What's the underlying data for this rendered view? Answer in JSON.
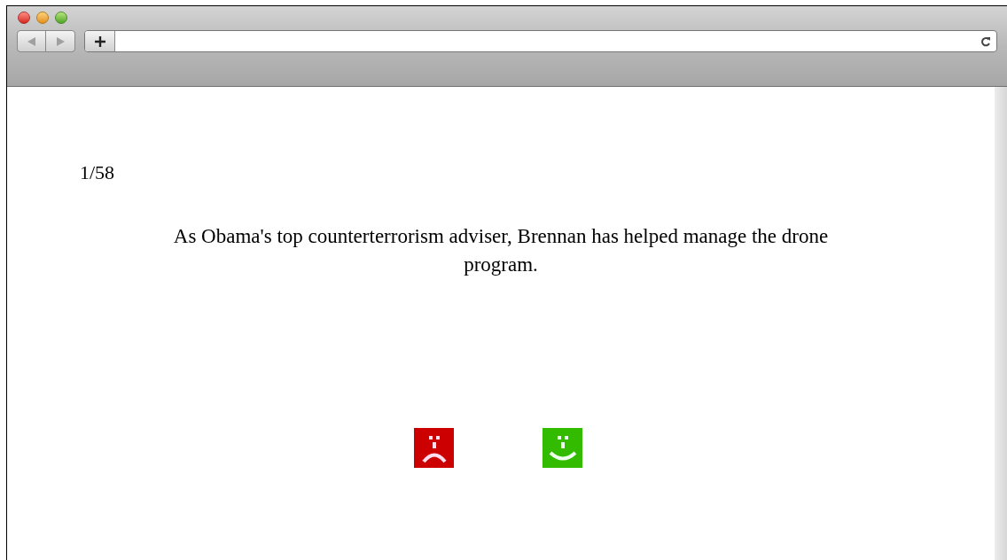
{
  "counter": "1/58",
  "statement": "As Obama's top counterterrorism adviser, Brennan has helped manage the drone program."
}
